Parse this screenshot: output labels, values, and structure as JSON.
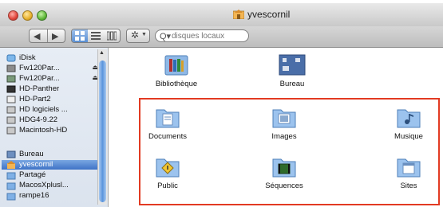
{
  "window": {
    "title": "yvescornil"
  },
  "toolbar": {
    "search_placeholder": "disques locaux"
  },
  "sidebar": {
    "devices": [
      {
        "label": "iDisk",
        "eject": ""
      },
      {
        "label": "Fw120Par...",
        "eject": "⏏"
      },
      {
        "label": "Fw120Par...",
        "eject": "⏏"
      },
      {
        "label": "HD-Panther",
        "eject": ""
      },
      {
        "label": "HD-Part2",
        "eject": ""
      },
      {
        "label": "HD logiciels ...",
        "eject": ""
      },
      {
        "label": "HDG4-9.22",
        "eject": ""
      },
      {
        "label": "Macintosh-HD",
        "eject": ""
      }
    ],
    "places": [
      {
        "label": "Bureau"
      },
      {
        "label": "yvescornil"
      },
      {
        "label": "Partagé"
      },
      {
        "label": "MacosXplusl..."
      },
      {
        "label": "rampe16"
      }
    ]
  },
  "content": {
    "row1": [
      {
        "label": "Bibliothèque"
      },
      {
        "label": "Bureau"
      }
    ],
    "row2": [
      {
        "label": "Documents"
      },
      {
        "label": "Images"
      },
      {
        "label": "Musique"
      }
    ],
    "row3": [
      {
        "label": "Public"
      },
      {
        "label": "Séquences"
      },
      {
        "label": "Sites"
      }
    ]
  },
  "colors": {
    "highlight": "#e23a22",
    "selection": "#3f73c6"
  }
}
